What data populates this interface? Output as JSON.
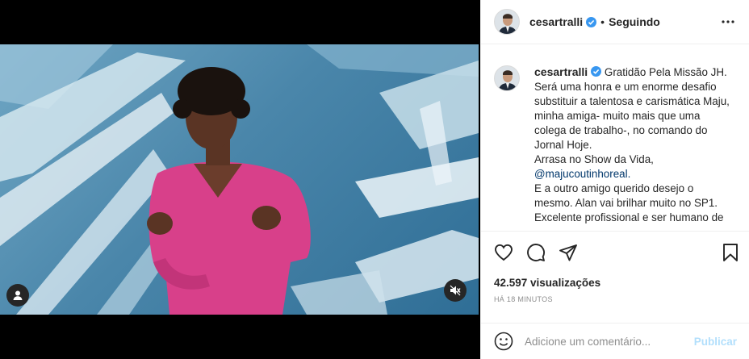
{
  "post": {
    "username": "cesartralli",
    "separator": "•",
    "follow_status": "Seguindo"
  },
  "caption": {
    "username": "cesartralli",
    "lines": [
      "Gratidão Pela Missão JH.",
      "Será uma honra e um enorme desafio",
      "substituir a talentosa e carismática Maju,",
      "minha amiga- muito mais que uma",
      "colega de trabalho-, no comando do",
      "Jornal Hoje.",
      "Arrasa no Show da Vida,",
      "@majucoutinhoreal.",
      "E a outro amigo querido desejo o",
      "mesmo. Alan vai brilhar muito no SP1.",
      "Excelente profissional e ser humano de"
    ]
  },
  "stats": {
    "views": "42.597 visualizações",
    "time_ago": "HÁ 18 MINUTOS"
  },
  "comment": {
    "placeholder": "Adicione um comentário...",
    "publish_label": "Publicar"
  },
  "icons": {
    "more": "more-options-icon",
    "like": "heart-icon",
    "comment": "comment-bubble-icon",
    "share": "paper-plane-icon",
    "save": "bookmark-icon",
    "emoji": "emoji-icon",
    "mute": "sound-off-icon",
    "tag": "user-tag-icon",
    "verified": "verified-badge-icon"
  },
  "colors": {
    "verified": "#3897f0",
    "mention": "#00376b",
    "publish_disabled": "#b2dffc",
    "dress": "#d8408a"
  }
}
